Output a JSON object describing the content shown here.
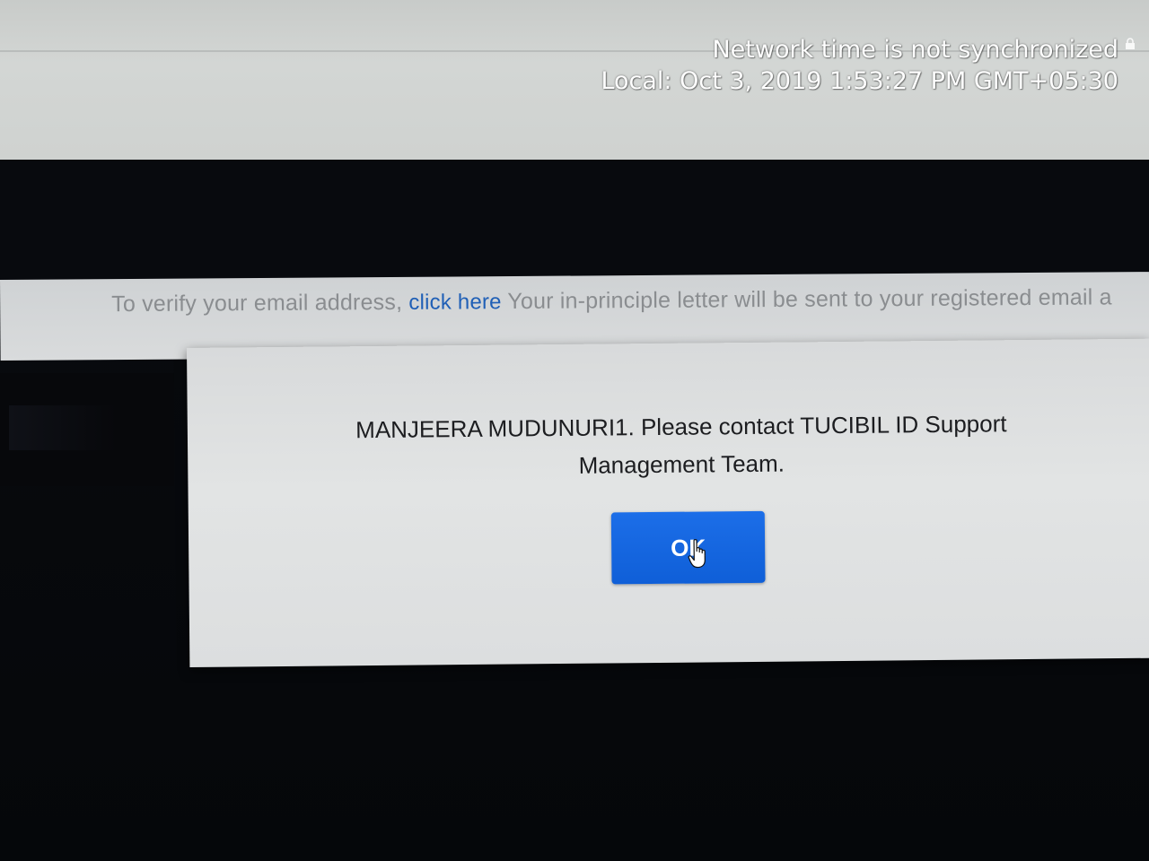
{
  "status_overlay": {
    "line1": "Network time is not synchronized",
    "line2": "Local: Oct 3, 2019 1:53:27 PM GMT+05:30"
  },
  "notice": {
    "prefix": "To verify your email address, ",
    "link_label": "click here",
    "suffix": " Your in-principle letter will be sent to your registered email a"
  },
  "dialog": {
    "message": "MANJEERA MUDUNURI1. Please contact TUCIBIL ID Support Management Team.",
    "ok_label": "OK"
  },
  "colors": {
    "button": "#1266e0",
    "link": "#1f5fb6"
  }
}
